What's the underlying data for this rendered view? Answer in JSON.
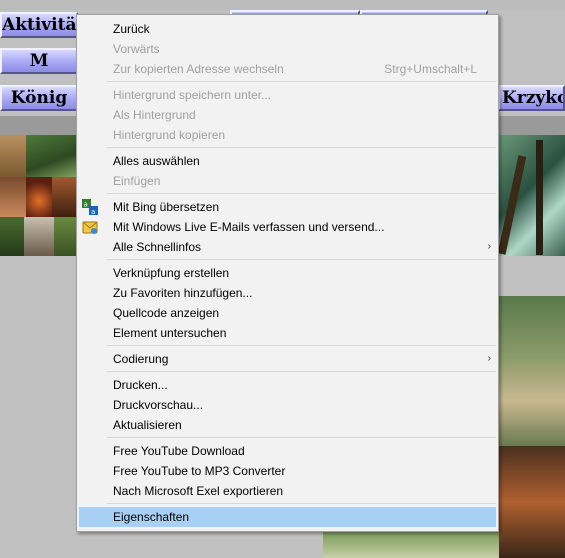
{
  "page": {
    "nav_buttons": [
      {
        "label": "Aktivitäten"
      },
      {
        "label": "M"
      },
      {
        "label": "König"
      },
      {
        "label": "Krzykow"
      }
    ],
    "colors": {
      "button_blue": "#a8a8f4",
      "page_background": "#c0c0c0",
      "menu_background": "#f2f2f2",
      "menu_highlight": "#a8d0f4"
    }
  },
  "context_menu": {
    "items": [
      {
        "label": "Zurück",
        "enabled": true
      },
      {
        "label": "Vorwärts",
        "enabled": false
      },
      {
        "label": "Zur kopierten Adresse wechseln",
        "shortcut": "Strg+Umschalt+L",
        "enabled": false
      },
      {
        "label": "Hintergrund speichern unter...",
        "enabled": false
      },
      {
        "label": "Als Hintergrund",
        "enabled": false
      },
      {
        "label": "Hintergrund kopieren",
        "enabled": false
      },
      {
        "label": "Alles auswählen",
        "enabled": true
      },
      {
        "label": "Einfügen",
        "enabled": false
      },
      {
        "label": "Mit Bing übersetzen",
        "enabled": true,
        "icon": "bing-translate-icon"
      },
      {
        "label": "Mit Windows Live E-Mails verfassen und versend...",
        "enabled": true,
        "icon": "windows-live-mail-icon"
      },
      {
        "label": "Alle Schnellinfos",
        "enabled": true,
        "submenu": true
      },
      {
        "label": "Verknüpfung erstellen",
        "enabled": true
      },
      {
        "label": "Zu Favoriten hinzufügen...",
        "enabled": true
      },
      {
        "label": "Quellcode anzeigen",
        "enabled": true
      },
      {
        "label": "Element untersuchen",
        "enabled": true
      },
      {
        "label": "Codierung",
        "enabled": true,
        "submenu": true
      },
      {
        "label": "Drucken...",
        "enabled": true
      },
      {
        "label": "Druckvorschau...",
        "enabled": true
      },
      {
        "label": "Aktualisieren",
        "enabled": true
      },
      {
        "label": "Free YouTube Download",
        "enabled": true
      },
      {
        "label": "Free YouTube to MP3 Converter",
        "enabled": true
      },
      {
        "label": "Nach Microsoft Exel exportieren",
        "enabled": true
      },
      {
        "label": "Eigenschaften",
        "enabled": true,
        "highlighted": true
      }
    ]
  }
}
